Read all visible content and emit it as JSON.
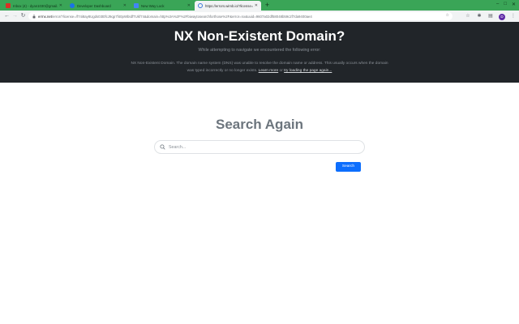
{
  "browser": {
    "tabs": [
      {
        "title": "Inbox (4) - dyan1030@gmail.co...",
        "icon": "gmail-icon",
        "color": "#d93025",
        "active": false
      },
      {
        "title": "Developer Dashboard",
        "icon": "chrome-web-store-icon",
        "color": "#1a73e8",
        "active": false
      },
      {
        "title": "New Way Lock",
        "icon": "page-icon",
        "color": "#4285f4",
        "active": false
      },
      {
        "title": "https://errors.wimb.io/?license=",
        "icon": "loading-icon",
        "color": "#3c78d8",
        "active": true
      }
    ],
    "new_tab_label": "+",
    "url_host": "errnx.net",
    "url_rest": "/error/?license=/f74i8ay8Ugds03t0fcJ9qp7f40pWbIdfTUkf74&domain=http%3A%2F%2Fbiwaytosearchforthose%2F&error=nx&uuid=9607a02df58048b59c2f7da9400ae4",
    "accent": "#3aa557"
  },
  "hero": {
    "title": "NX Non-Existent Domain?",
    "subtitle": "While attempting to navigate we encountered the following error:",
    "description": "NX Non-Existent Domain. The domain name system (DNS) was unable to resolve the domain name or address. This usually occurs when the domain was typed incorrectly or no longer exists.",
    "learn_more": "Learn more",
    "or_text": " or ",
    "reload_link": "try loading the page again...",
    "bg_color": "#212529"
  },
  "search": {
    "title": "Search Again",
    "placeholder": "Search...",
    "button_label": "Search",
    "button_color": "#0d6efd"
  }
}
